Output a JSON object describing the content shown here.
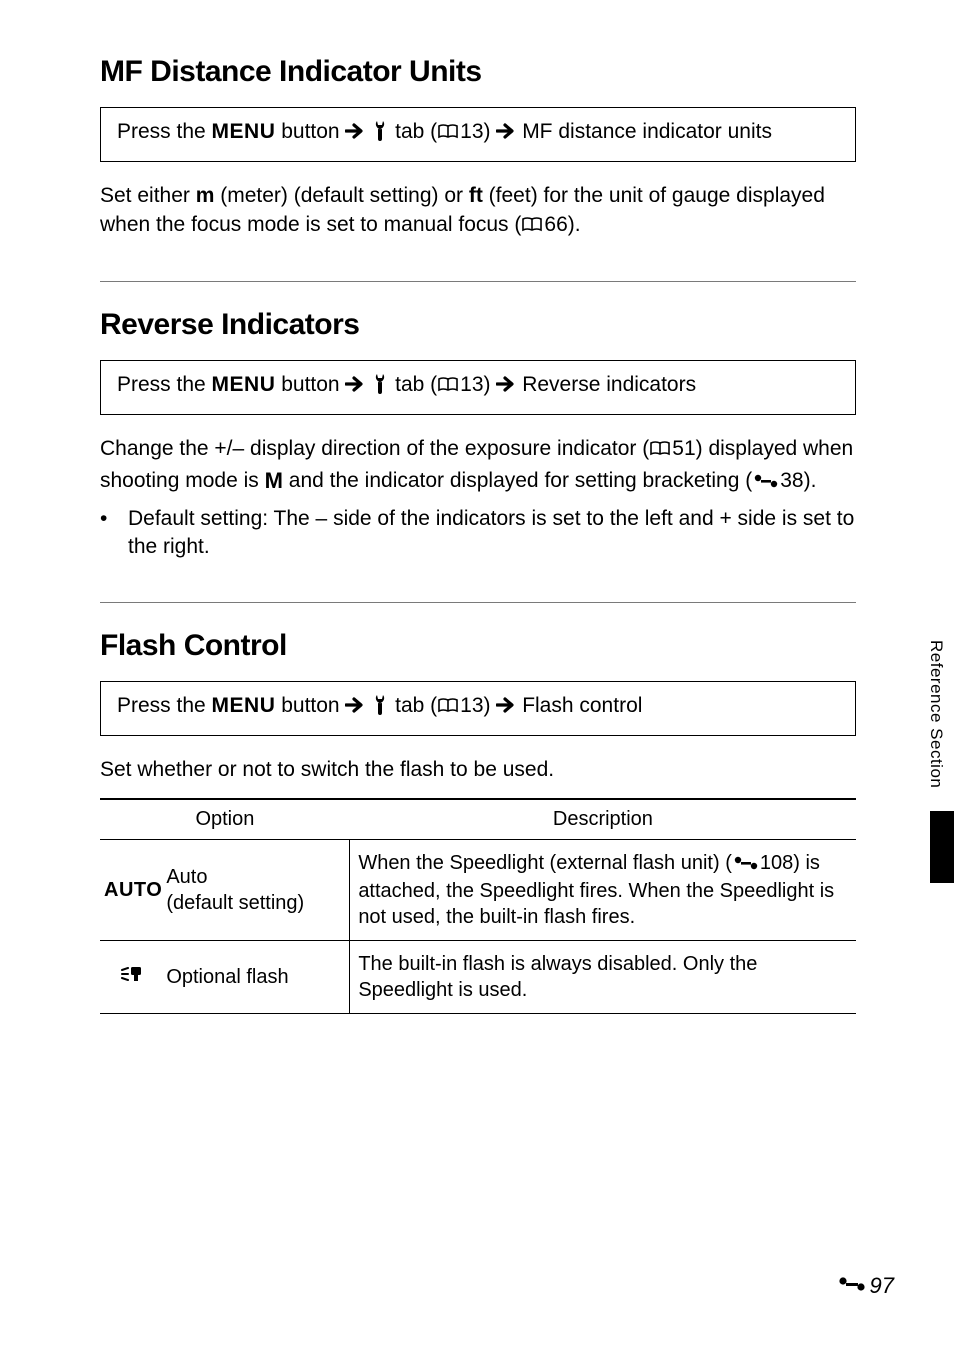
{
  "sideTab": {
    "label": "Reference Section"
  },
  "pageNumber": "97",
  "sections": [
    {
      "id": "mf",
      "title": "MF Distance Indicator Units",
      "nav": {
        "prefix": "Press the ",
        "menu": "MENU",
        "afterMenu": " button ",
        "tabRef": "13",
        "tabSuffix": ") ",
        "dest": " MF distance indicator units"
      },
      "body": {
        "pre": "Set either ",
        "mBold": "m",
        "mAfter": " (meter) (default setting) or ",
        "ftBold": "ft",
        "ftAfter": " (feet) for the unit of gauge displayed when the focus mode is set to manual focus (",
        "ref": "66",
        "post": ")."
      }
    },
    {
      "id": "rev",
      "title": "Reverse Indicators",
      "nav": {
        "prefix": "Press the ",
        "menu": "MENU",
        "afterMenu": " button ",
        "tabRef": "13",
        "tabSuffix": ") ",
        "dest": " Reverse indicators"
      },
      "body": {
        "p1a": "Change the +/– display direction of the exposure indicator (",
        "p1ref1": "51",
        "p1b": ") displayed when shooting mode is ",
        "modeM": "M",
        "p1c": " and the indicator displayed for setting bracketing (",
        "p1ref2": "38",
        "p1d": ")."
      },
      "bullet": "Default setting: The – side of the indicators is set to the left and + side is set to the right."
    },
    {
      "id": "flash",
      "title": "Flash Control",
      "nav": {
        "prefix": "Press the ",
        "menu": "MENU",
        "afterMenu": " button ",
        "tabRef": "13",
        "tabSuffix": ") ",
        "dest": " Flash control"
      },
      "intro": "Set whether or not to switch the flash to be used.",
      "table": {
        "headers": {
          "option": "Option",
          "description": "Description"
        },
        "rows": [
          {
            "iconText": "AUTO",
            "label": "Auto\n(default setting)",
            "descPre": "When the Speedlight (external flash unit) (",
            "descRef": "108",
            "descPost": ") is attached, the Speedlight fires. When the Speedlight is not used, the built-in flash fires."
          },
          {
            "iconSvg": true,
            "label": "Optional flash",
            "desc": "The built-in flash is always disabled. Only the Speedlight is used."
          }
        ]
      }
    }
  ]
}
